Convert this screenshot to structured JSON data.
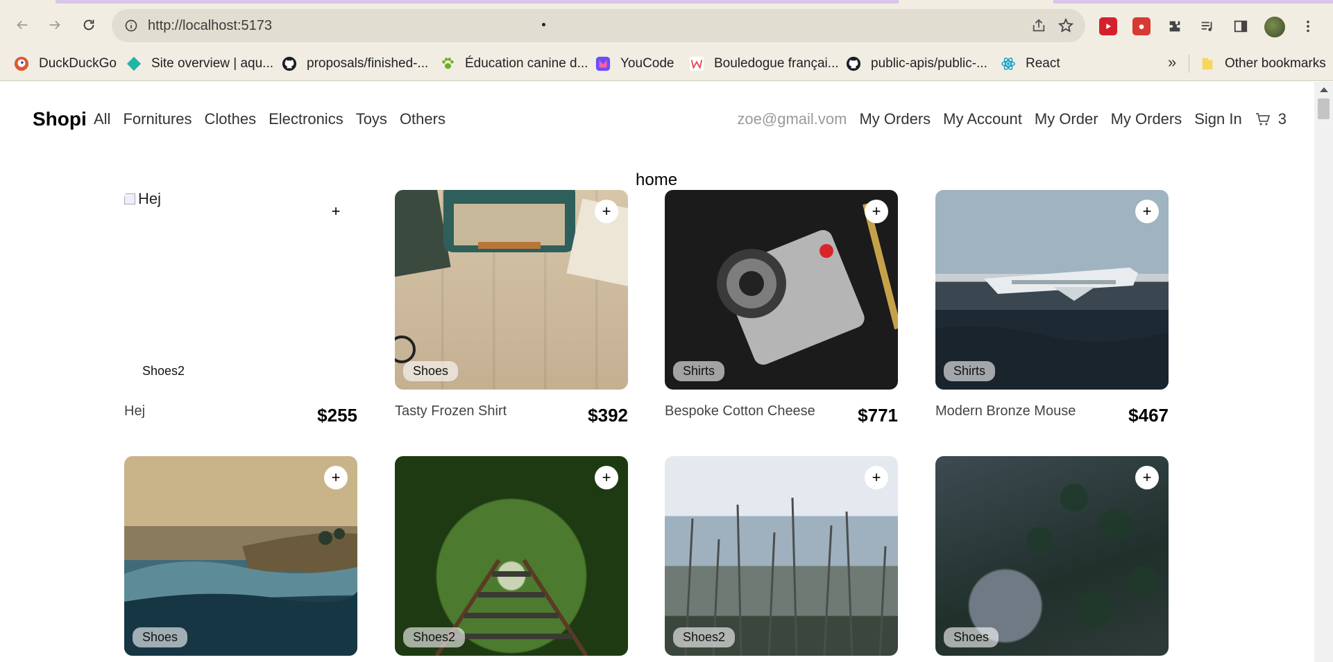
{
  "browser": {
    "url": "http://localhost:5173",
    "bookmarks": [
      {
        "label": "DuckDuckGo",
        "icon": "duckduckgo-icon"
      },
      {
        "label": "Site overview | aqu...",
        "icon": "diamond-icon"
      },
      {
        "label": "proposals/finished-...",
        "icon": "github-icon"
      },
      {
        "label": "Éducation canine d...",
        "icon": "paw-icon"
      },
      {
        "label": "YouCode",
        "icon": "youcode-icon"
      },
      {
        "label": "Bouledogue françai...",
        "icon": "w-icon"
      },
      {
        "label": "public-apis/public-...",
        "icon": "github-icon"
      },
      {
        "label": "React",
        "icon": "react-icon"
      }
    ],
    "more_bookmarks": "»",
    "other_bookmarks": "Other bookmarks"
  },
  "site": {
    "brand": "Shopi",
    "nav_left": [
      "All",
      "Fornitures",
      "Clothes",
      "Electronics",
      "Toys",
      "Others"
    ],
    "user_email": "zoe@gmail.vom",
    "nav_right": [
      "My Orders",
      "My Account",
      "My Order",
      "My Orders",
      "Sign In"
    ],
    "cart_count": "3",
    "heading": "home"
  },
  "products": [
    {
      "name": "Hej",
      "price": "$255",
      "category": "Shoes2",
      "image": "broken",
      "alt": "Hej"
    },
    {
      "name": "Tasty Frozen Shirt",
      "price": "$392",
      "category": "Shoes",
      "image": "typewriter"
    },
    {
      "name": "Bespoke Cotton Cheese",
      "price": "$771",
      "category": "Shirts",
      "image": "camera"
    },
    {
      "name": "Modern Bronze Mouse",
      "price": "$467",
      "category": "Shirts",
      "image": "plane"
    },
    {
      "name": "",
      "price": "",
      "category": "Shoes",
      "image": "wave"
    },
    {
      "name": "",
      "price": "",
      "category": "Shoes2",
      "image": "railway"
    },
    {
      "name": "",
      "price": "",
      "category": "Shoes2",
      "image": "forest"
    },
    {
      "name": "",
      "price": "",
      "category": "Shoes",
      "image": "aerial"
    }
  ],
  "add_label": "+"
}
